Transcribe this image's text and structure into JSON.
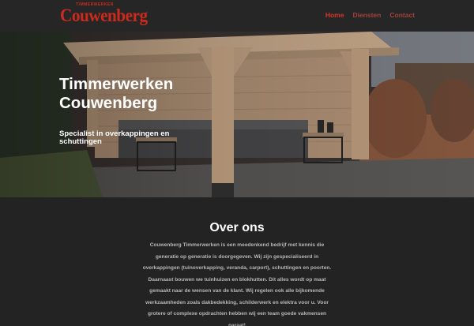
{
  "header": {
    "logo_small": "TIMMERWERKEN",
    "logo_main": "Couwenberg",
    "nav": [
      {
        "label": "Home",
        "active": true
      },
      {
        "label": "Diensten",
        "active": false
      },
      {
        "label": "Contact",
        "active": false
      }
    ]
  },
  "hero": {
    "title": "Timmerwerken Couwenberg",
    "subtitle": "Specialist in overkappingen en schuttingen"
  },
  "about": {
    "title": "Over ons",
    "text": "Couwenberg Timmerwerken is een meedenkend bedrijf met kennis die generatie op generatie is doorgegeven. Wij zijn gespecialiseerd in overkappingen (tuinoverkapping, veranda, carport), schuttingen en poorten. Daarnaast bouwen we tuinhuizen en blokhutten. Dit alles wordt op maat gemaakt naar de wensen van de klant. Wij regelen ook alle bijkomende werkzaamheden zoals dakbedekking, schilderwerk en elektra voor u. Voor grotere of complexe opdrachten hebben wij een team goede vakmensen paraat!"
  },
  "colors": {
    "brand_red": "#cc2a1e",
    "nav_active": "#d9352a",
    "nav_inactive": "#a2423c",
    "background": "#232323"
  }
}
